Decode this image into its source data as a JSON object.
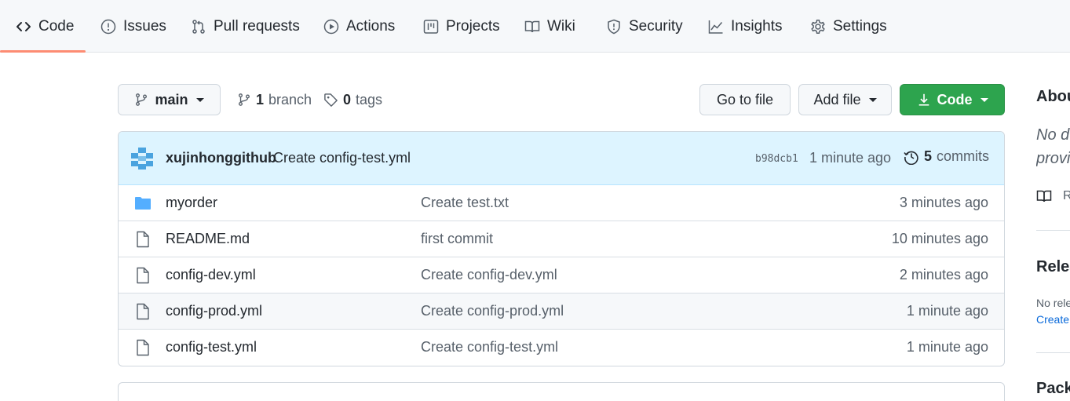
{
  "repo_nav": {
    "tabs": [
      {
        "label": "Code",
        "icon": "code-icon",
        "selected": true
      },
      {
        "label": "Issues",
        "icon": "issue-icon"
      },
      {
        "label": "Pull requests",
        "icon": "pull-request-icon"
      },
      {
        "label": "Actions",
        "icon": "play-icon"
      },
      {
        "label": "Projects",
        "icon": "project-icon"
      },
      {
        "label": "Wiki",
        "icon": "book-icon"
      },
      {
        "label": "Security",
        "icon": "shield-icon"
      },
      {
        "label": "Insights",
        "icon": "graph-icon"
      },
      {
        "label": "Settings",
        "icon": "gear-icon"
      }
    ],
    "selected_color": "#fd8c73"
  },
  "branch_bar": {
    "branch_name": "main",
    "branch_count": "1",
    "branch_word": "branch",
    "tag_count": "0",
    "tag_word": "tags",
    "go_to_file": "Go to file",
    "add_file": "Add file",
    "code_button": "Code",
    "code_button_color": "#2da44e"
  },
  "latest_commit": {
    "author": "xujinhonggithub",
    "message": "Create config-test.yml",
    "sha": "b98dcb1",
    "time": "1 minute ago",
    "commit_count": "5",
    "commit_word": "commits"
  },
  "files": [
    {
      "name": "myorder",
      "type": "folder",
      "message": "Create test.txt",
      "time": "3 minutes ago"
    },
    {
      "name": "README.md",
      "type": "file",
      "message": "first commit",
      "time": "10 minutes ago"
    },
    {
      "name": "config-dev.yml",
      "type": "file",
      "message": "Create config-dev.yml",
      "time": "2 minutes ago"
    },
    {
      "name": "config-prod.yml",
      "type": "file",
      "message": "Create config-prod.yml",
      "time": "1 minute ago"
    },
    {
      "name": "config-test.yml",
      "type": "file",
      "message": "Create config-test.yml",
      "time": "1 minute ago"
    }
  ],
  "sidebar": {
    "about_heading": "Abou",
    "about_desc_line1": "No de",
    "about_desc_line2": "provi",
    "readme_letter": "R",
    "releases_heading": "Relea",
    "releases_text": "No rele",
    "releases_link": "Create",
    "packages_heading": "Packa"
  }
}
